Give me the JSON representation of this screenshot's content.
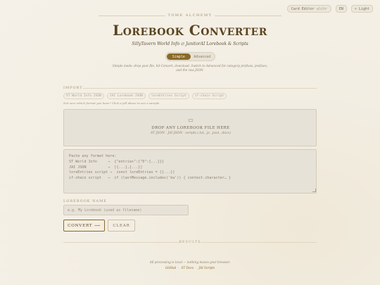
{
  "topbar": {
    "card_editor_label": "Card Editor",
    "card_editor_suffix": "alchr",
    "lang_label": "EN",
    "theme_label": "☀ Light"
  },
  "header": {
    "kicker": "TOME ALCHEMY",
    "title": "Lorebook Converter",
    "subtitle": "SillyTavern World Info ⇄ JanitorAI Lorebook & Scripts"
  },
  "mode": {
    "options": [
      "Simple",
      "Advanced"
    ],
    "selected": "Simple",
    "hint_line1": "Simple mode: drop your file, hit Convert, download. Switch to Advanced for category prefixes, prefixes,",
    "hint_line2": "and the raw JSON."
  },
  "import": {
    "label": "IMPORT",
    "chips": [
      "ST World Info JSON",
      "JAI Lorebook JSON",
      "loreEntries Script",
      "if-chain Script"
    ],
    "chip_hint": "Not sure which format you have? Click a pill above to see a sample.",
    "drop_title": "DROP ANY LOREBOOK FILE HERE",
    "drop_sub": "ST JSON · JAI JSON · scripts (.txt, .js, .json, .docx)",
    "paste_placeholder": "Paste any format here:\nST World Info     →  {\"entries\":{\"0\":{...}}}\nJAI JSON          →  [{...},{...}]\nloreEntries script →  const loreEntries = [{...}]\nif-chain script   →  if (lastMessage.includes('kw')) { context.character… }"
  },
  "name": {
    "label": "LOREBOOK NAME",
    "placeholder": "e.g. My Lorebook (used as filename)"
  },
  "actions": {
    "convert_label": "CONVERT ⟶",
    "clear_label": "CLEAR"
  },
  "results": {
    "label": "RESULTS"
  },
  "footer": {
    "line1": "All processing is local — nothing leaves your browser.",
    "links": [
      "GitHub",
      "ST Docs",
      "JAI Scripts"
    ]
  },
  "colors": {
    "accent": "#8a6a2a",
    "background": "#f3eee3",
    "panel": "#e7e2d8"
  }
}
